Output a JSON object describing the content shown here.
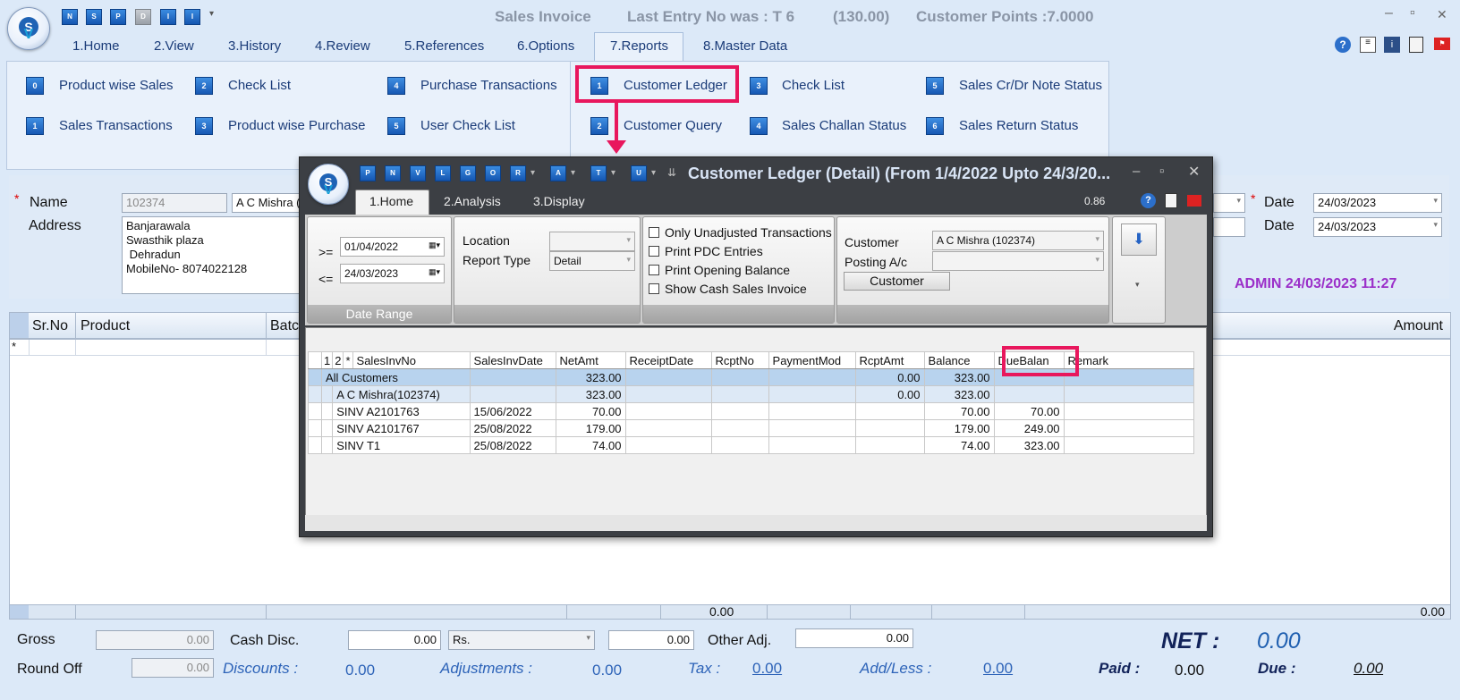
{
  "titlebar": {
    "title": "Sales Invoice",
    "last_entry": "Last Entry No was : T 6",
    "amount": "(130.00)",
    "points": "Customer Points :7.0000",
    "quick_icons": [
      "N",
      "S",
      "P",
      "D",
      "I",
      "I"
    ]
  },
  "menu": [
    "1.Home",
    "2.View",
    "3.History",
    "4.Review",
    "5.References",
    "6.Options",
    "7.Reports",
    "8.Master Data"
  ],
  "ribbon": {
    "left": [
      {
        "icon": "0",
        "label": "Product wise Sales"
      },
      {
        "icon": "2",
        "label": "Check List"
      },
      {
        "icon": "4",
        "label": "Purchase Transactions"
      },
      {
        "icon": "1",
        "label": "Sales Transactions"
      },
      {
        "icon": "3",
        "label": "Product wise Purchase"
      },
      {
        "icon": "5",
        "label": "User Check List"
      }
    ],
    "right": [
      {
        "icon": "1",
        "label": "Customer Ledger"
      },
      {
        "icon": "3",
        "label": "Check List"
      },
      {
        "icon": "5",
        "label": "Sales Cr/Dr Note Status"
      },
      {
        "icon": "2",
        "label": "Customer Query"
      },
      {
        "icon": "4",
        "label": "Sales Challan Status"
      },
      {
        "icon": "6",
        "label": "Sales Return Status"
      }
    ]
  },
  "form": {
    "name_label": "Name",
    "name_code": "102374",
    "name_value": "A C Mishra (",
    "address_label": "Address",
    "address_lines": [
      "Banjarawala",
      "Swasthik plaza",
      " Dehradun",
      "MobileNo- 8074022128"
    ],
    "date_label": "Date",
    "date1": "24/03/2023",
    "date2": "24/03/2023",
    "admin_info": "ADMIN 24/03/2023 11:27"
  },
  "main_grid": {
    "headers": [
      "Sr.No",
      "Product",
      "Batc",
      "Amount"
    ],
    "footer_total_mid": "0.00",
    "footer_total_right": "0.00"
  },
  "bottom": {
    "gross_label": "Gross",
    "gross_value": "0.00",
    "cash_disc_label": "Cash Disc.",
    "cash_disc_value": "0.00",
    "cash_disc_unit": "Rs.",
    "cash_disc_value2": "0.00",
    "other_adj_label": "Other Adj.",
    "other_adj_value": "0.00",
    "net_label": "NET :",
    "net_value": "0.00",
    "round_off_label": "Round Off",
    "round_off_value": "0.00",
    "discounts_label": "Discounts :",
    "discounts_value": "0.00",
    "adjustments_label": "Adjustments :",
    "adjustments_value": "0.00",
    "tax_label": "Tax :",
    "tax_value": "0.00",
    "addless_label": "Add/Less :",
    "addless_value": "0.00",
    "paid_label": "Paid :",
    "paid_value": "0.00",
    "due_label": "Due :",
    "due_value": "0.00"
  },
  "dialog": {
    "title": "Customer Ledger (Detail)  (From 1/4/2022 Upto 24/3/20...",
    "quick_icons": [
      "P",
      "N",
      "V",
      "L",
      "G",
      "O",
      "R",
      "A",
      "T",
      "U"
    ],
    "menu": [
      "1.Home",
      "2.Analysis",
      "3.Display"
    ],
    "zoom": "0.86",
    "date_from_op": ">=",
    "date_from": "01/04/2022",
    "date_to_op": "<=",
    "date_to": "24/03/2023",
    "date_range_label": "Date Range",
    "location_label": "Location",
    "location_value": "",
    "report_type_label": "Report Type",
    "report_type_value": "Detail",
    "checks": [
      "Only Unadjusted Transactions",
      "Print PDC Entries",
      "Print Opening Balance",
      "Show Cash Sales Invoice"
    ],
    "customer_label": "Customer",
    "customer_value": "A C Mishra (102374)",
    "posting_label": "Posting A/c",
    "posting_value": "",
    "customer_button": "Customer",
    "columns": [
      "1",
      "2",
      "*",
      "SalesInvNo",
      "SalesInvDate",
      "NetAmt",
      "ReceiptDate",
      "RcptNo",
      "PaymentMod",
      "RcptAmt",
      "Balance",
      "DueBalan",
      "Remark"
    ],
    "rows": [
      {
        "inv": "All Customers",
        "date": "",
        "net": "323.00",
        "rdate": "",
        "rno": "",
        "pmode": "",
        "ramt": "0.00",
        "bal": "323.00",
        "due": "",
        "remark": ""
      },
      {
        "inv": "A C Mishra(102374)",
        "date": "",
        "net": "323.00",
        "rdate": "",
        "rno": "",
        "pmode": "",
        "ramt": "0.00",
        "bal": "323.00",
        "due": "",
        "remark": ""
      },
      {
        "inv": "SINV A2101763",
        "date": "15/06/2022",
        "net": "70.00",
        "rdate": "",
        "rno": "",
        "pmode": "",
        "ramt": "",
        "bal": "70.00",
        "due": "70.00",
        "remark": ""
      },
      {
        "inv": "SINV A2101767",
        "date": "25/08/2022",
        "net": "179.00",
        "rdate": "",
        "rno": "",
        "pmode": "",
        "ramt": "",
        "bal": "179.00",
        "due": "249.00",
        "remark": ""
      },
      {
        "inv": "SINV T1",
        "date": "25/08/2022",
        "net": "74.00",
        "rdate": "",
        "rno": "",
        "pmode": "",
        "ramt": "",
        "bal": "74.00",
        "due": "323.00",
        "remark": ""
      }
    ]
  },
  "colors": {
    "highlight": "#e8175d",
    "accent": "#1f63b5",
    "admin": "#9b2fc9",
    "net": "#1f5fb0"
  }
}
